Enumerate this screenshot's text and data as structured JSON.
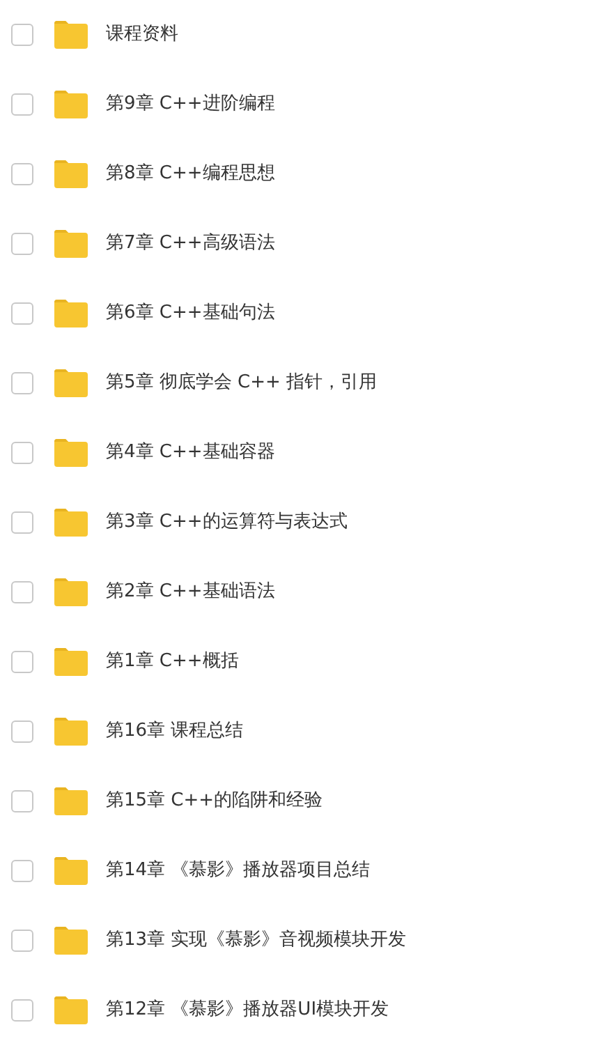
{
  "folders": [
    {
      "name": "课程资料",
      "checked": false
    },
    {
      "name": "第9章 C++进阶编程",
      "checked": false
    },
    {
      "name": "第8章 C++编程思想",
      "checked": false
    },
    {
      "name": "第7章 C++高级语法",
      "checked": false
    },
    {
      "name": "第6章 C++基础句法",
      "checked": false
    },
    {
      "name": "第5章 彻底学会 C++ 指针，引用",
      "checked": false
    },
    {
      "name": "第4章 C++基础容器",
      "checked": false
    },
    {
      "name": "第3章 C++的运算符与表达式",
      "checked": false
    },
    {
      "name": "第2章 C++基础语法",
      "checked": false
    },
    {
      "name": "第1章 C++概括",
      "checked": false
    },
    {
      "name": "第16章 课程总结",
      "checked": false
    },
    {
      "name": "第15章 C++的陷阱和经验",
      "checked": false
    },
    {
      "name": "第14章 《慕影》播放器项目总结",
      "checked": false
    },
    {
      "name": "第13章 实现《慕影》音视频模块开发",
      "checked": false
    },
    {
      "name": "第12章 《慕影》播放器UI模块开发",
      "checked": false
    }
  ]
}
